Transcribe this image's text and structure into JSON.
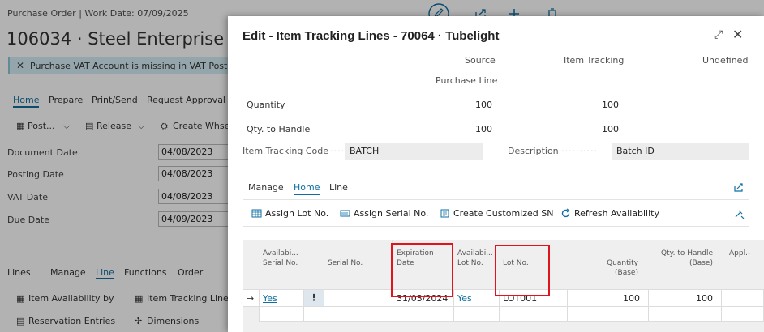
{
  "background": {
    "breadcrumb": "Purchase Order | Work Date: 07/09/2025",
    "title": "106034 · Steel Enterprise Reg",
    "banner": "Purchase VAT Account is missing in VAT Posting",
    "tabs": [
      "Home",
      "Prepare",
      "Print/Send",
      "Request Approval"
    ],
    "actions": [
      "Post...",
      "Release",
      "Create Whse."
    ],
    "fields": [
      {
        "label": "Document Date",
        "value": "04/08/2023"
      },
      {
        "label": "Posting Date",
        "value": "04/08/2023"
      },
      {
        "label": "VAT Date",
        "value": "04/08/2023"
      },
      {
        "label": "Due Date",
        "value": "04/09/2023"
      }
    ],
    "lines_tabs": [
      "Lines",
      "Manage",
      "Line",
      "Functions",
      "Order"
    ],
    "lines_actions": [
      "Item Availability by",
      "Item Tracking Lines",
      "Reservation Entries",
      "Dimensions"
    ]
  },
  "dialog": {
    "title": "Edit - Item Tracking Lines - 70064 · Tubelight",
    "columns": {
      "source": "Source",
      "source_sub": "Purchase Line",
      "tracking": "Item Tracking",
      "undefined": "Undefined"
    },
    "rows": [
      {
        "label": "Quantity",
        "source": "100",
        "tracking": "100"
      },
      {
        "label": "Qty. to Handle",
        "source": "100",
        "tracking": "100"
      }
    ],
    "item_tracking_code": {
      "label": "Item Tracking Code",
      "value": "BATCH"
    },
    "description": {
      "label": "Description",
      "value": "Batch ID"
    },
    "tabs": {
      "manage": "Manage",
      "home": "Home",
      "line": "Line"
    },
    "actions": {
      "assign_lot": "Assign Lot No.",
      "assign_serial": "Assign Serial No.",
      "create_sn": "Create Customized SN",
      "refresh": "Refresh Availability"
    },
    "grid": {
      "headers": {
        "avail_serial_1": "Availabi...",
        "avail_serial_2": "Serial No.",
        "serial": "Serial No.",
        "exp_1": "Expiration",
        "exp_2": "Date",
        "avail_lot_1": "Availabi...",
        "avail_lot_2": "Lot No.",
        "lot": "Lot No.",
        "qty_base": "Quantity (Base)",
        "qth_1": "Qty. to Handle",
        "qth_2": "(Base)",
        "appl": "Appl.-"
      },
      "row": {
        "avail_serial": "Yes",
        "menu": "⋮",
        "serial": "",
        "expiration": "31/03/2024",
        "avail_lot": "Yes",
        "lot": "LOT001",
        "qty_base": "100",
        "qty_to_handle": "100"
      }
    }
  },
  "colors": {
    "accent": "#0f6fa0",
    "highlight": "#e0141e"
  }
}
